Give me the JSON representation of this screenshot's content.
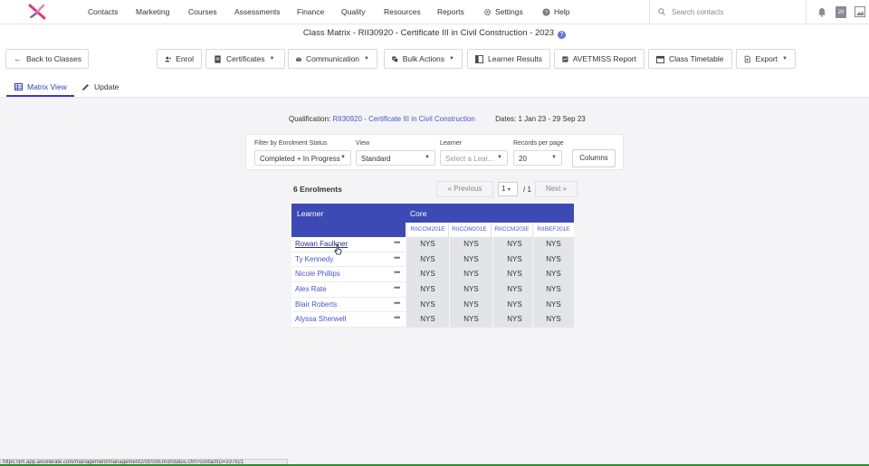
{
  "topnav": {
    "logo": "axcelerate-logo",
    "items": [
      "Contacts",
      "Marketing",
      "Courses",
      "Assessments",
      "Finance",
      "Quality",
      "Resources",
      "Reports",
      "Settings",
      "Help"
    ],
    "search_placeholder": "Search contacts",
    "calendar_day": "20"
  },
  "page": {
    "title": "Class Matrix - RII30920 - Certificate III in Civil Construction - 2023"
  },
  "actions": {
    "back": "Back to Classes",
    "enrol": "Enrol",
    "certificates": "Certificates",
    "communication": "Communication",
    "bulk_actions": "Bulk Actions",
    "learner_results": "Learner Results",
    "avetmiss": "AVETMISS Report",
    "timetable": "Class Timetable",
    "export": "Export"
  },
  "tabs": {
    "matrix": "Matrix View",
    "update": "Update"
  },
  "qualification": {
    "label": "Qualification:",
    "value": "RII30920 - Certificate III in Civil Construction",
    "dates": "Dates: 1 Jan 23 - 29 Sep 23"
  },
  "filters": {
    "status_label": "Filter by Enrolment Status",
    "status_value": "Completed + In Progress",
    "view_label": "View",
    "view_value": "Standard",
    "learner_label": "Learner",
    "learner_placeholder": "Select a Lear...",
    "records_label": "Records per page",
    "records_value": "20",
    "columns_button": "Columns"
  },
  "pagination": {
    "count": "6 Enrolments",
    "previous": "« Previous",
    "page": "1",
    "of": "/ 1",
    "next": "Next »"
  },
  "matrix": {
    "learner_header": "Learner",
    "group_header": "Core",
    "units": [
      "RIICCM201E",
      "RIICOM201E",
      "RIICCM203E",
      "RIIBEF201E"
    ],
    "rows": [
      {
        "name": "Rowan Faulkner",
        "results": [
          "NYS",
          "NYS",
          "NYS",
          "NYS"
        ]
      },
      {
        "name": "Ty Kennedy",
        "results": [
          "NYS",
          "NYS",
          "NYS",
          "NYS"
        ]
      },
      {
        "name": "Nicole Phillips",
        "results": [
          "NYS",
          "NYS",
          "NYS",
          "NYS"
        ]
      },
      {
        "name": "Alex Rate",
        "results": [
          "NYS",
          "NYS",
          "NYS",
          "NYS"
        ]
      },
      {
        "name": "Blair Roberts",
        "results": [
          "NYS",
          "NYS",
          "NYS",
          "NYS"
        ]
      },
      {
        "name": "Alyssa Sherwell",
        "results": [
          "NYS",
          "NYS",
          "NYS",
          "NYS"
        ]
      }
    ]
  },
  "statusbar": {
    "url": "https://jm.app.axcelerate.com/management/management2/ctr/ctrEnrolStatus.cfm?contactID=337921"
  },
  "colors": {
    "accent": "#3d49b4",
    "link": "#4a54c8",
    "cell_bg": "#e3e4e7"
  }
}
